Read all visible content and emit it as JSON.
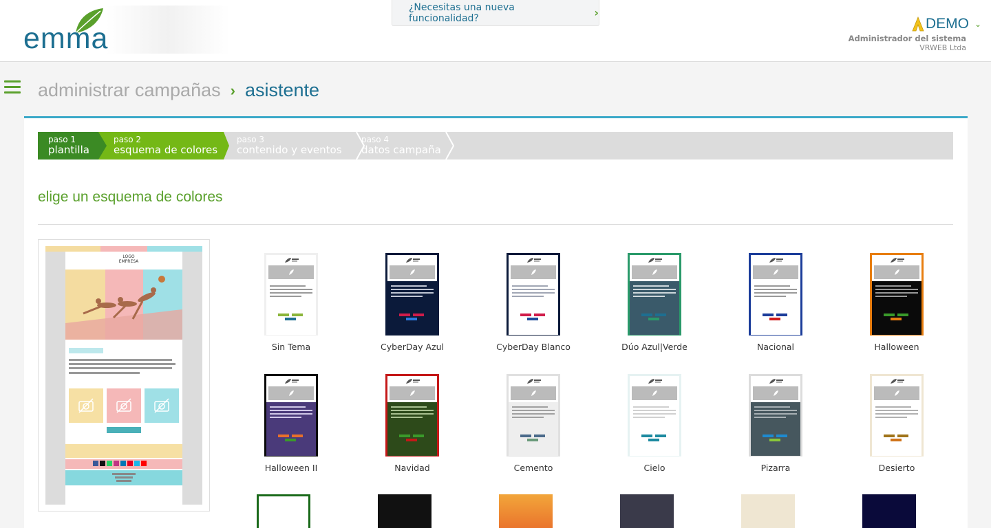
{
  "header": {
    "logo_text": "emma",
    "feature_request": "¿Necesitas una nueva funcionalidad?",
    "user": {
      "name": "DEMO",
      "role": "Administrador del sistema",
      "company": "VRWEB Ltda"
    }
  },
  "breadcrumb": {
    "parent": "administrar campañas",
    "current": "asistente"
  },
  "steps": [
    {
      "num": "paso 1",
      "label": "plantilla",
      "state": "done"
    },
    {
      "num": "paso 2",
      "label": "esquema de colores",
      "state": "active"
    },
    {
      "num": "paso 3",
      "label": "contenido y eventos",
      "state": "pending"
    },
    {
      "num": "paso 4",
      "label": "datos campaña",
      "state": "pending"
    }
  ],
  "section_title": "elige un esquema de colores",
  "preview": {
    "logo_text": "LOGO EMPRESA"
  },
  "themes": [
    {
      "name": "Sin Tema",
      "border": "#efefef",
      "bg": "#ffffff",
      "line": "#999999",
      "btn1": "#8bb53a",
      "btn2": "#1d6f91"
    },
    {
      "name": "CyberDay Azul",
      "border": "#0b1a3a",
      "bg": "#0b1a3a",
      "line": "#c0c6d4",
      "btn1": "#d01c4a",
      "btn2": "#2a7ae2"
    },
    {
      "name": "CyberDay Blanco",
      "border": "#0b1a3a",
      "bg": "#ffffff",
      "line": "#a0a6b4",
      "btn1": "#d01c4a",
      "btn2": "#1d4a9a"
    },
    {
      "name": "Dúo Azul|Verde",
      "border": "#2a9a6a",
      "bg": "#3a5a6a",
      "line": "#cfd8dc",
      "btn1": "#1d6f91",
      "btn2": "#2a9a6a"
    },
    {
      "name": "Nacional",
      "border": "#1c3d9a",
      "bg": "#ffffff",
      "line": "#999999",
      "btn1": "#1c3d9a",
      "btn2": "#d01c1c"
    },
    {
      "name": "Halloween",
      "border": "#e87e10",
      "bg": "#0a0a0a",
      "line": "#999999",
      "btn1": "#3a9a2a",
      "btn2": "#e87e10"
    },
    {
      "name": "Halloween II",
      "border": "#0a0a0a",
      "bg": "#4a3a7a",
      "line": "#d0c8e8",
      "btn1": "#e8702a",
      "btn2": "#3a9a2a"
    },
    {
      "name": "Navidad",
      "border": "#c41818",
      "bg": "#2d4a1a",
      "line": "#a8c090",
      "btn1": "#3a9a2a",
      "btn2": "#c41818"
    },
    {
      "name": "Cemento",
      "border": "#e0e0e0",
      "bg": "#eeeeee",
      "line": "#a0a0a0",
      "btn1": "#4a6a8a",
      "btn2": "#6a9a7a"
    },
    {
      "name": "Cielo",
      "border": "#e6f2f2",
      "bg": "#ffffff",
      "line": "#d0d0d0",
      "btn1": "#1d8aa0",
      "btn2": "#1d8aa0"
    },
    {
      "name": "Pizarra",
      "border": "#dcdcdc",
      "bg": "#46575e",
      "line": "#a8b0b4",
      "btn1": "#1d8ad0",
      "btn2": "#8ac83a"
    },
    {
      "name": "Desierto",
      "border": "#efe6d2",
      "bg": "#ffffff",
      "line": "#b0b0b0",
      "btn1": "#a0741a",
      "btn2": "#d0741a"
    }
  ]
}
